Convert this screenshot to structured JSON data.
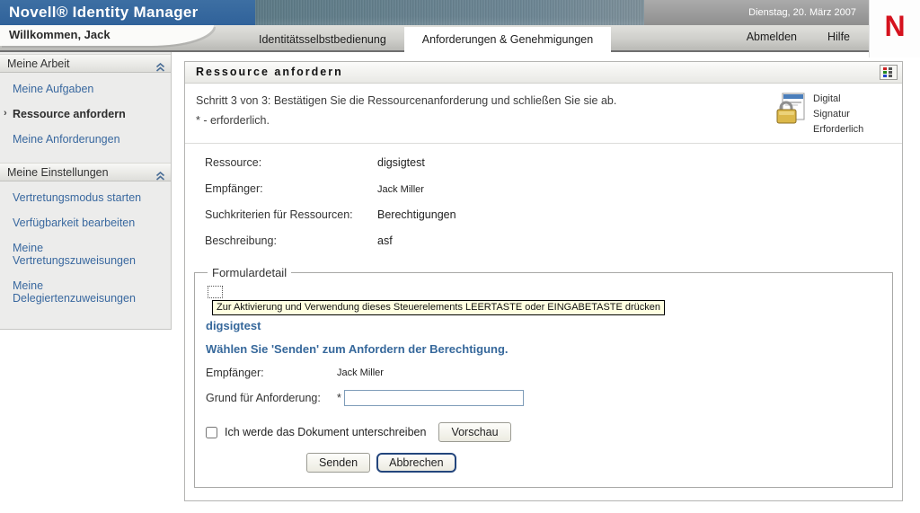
{
  "header": {
    "brand": "Novell® Identity Manager",
    "date": "Dienstag, 20. März 2007",
    "logo_letter": "N",
    "welcome": "Willkommen, Jack",
    "tabs": [
      {
        "label": "Identitätsselbstbedienung",
        "active": false
      },
      {
        "label": "Anforderungen & Genehmigungen",
        "active": true
      }
    ],
    "logout_label": "Abmelden",
    "help_label": "Hilfe"
  },
  "sidebar": {
    "sections": [
      {
        "title": "Meine Arbeit",
        "items": [
          {
            "label": "Meine Aufgaben",
            "active": false
          },
          {
            "label": "Ressource anfordern",
            "active": true
          },
          {
            "label": "Meine Anforderungen",
            "active": false
          }
        ]
      },
      {
        "title": "Meine Einstellungen",
        "items": [
          {
            "label": "Vertretungsmodus starten",
            "active": false
          },
          {
            "label": "Verfügbarkeit bearbeiten",
            "active": false
          },
          {
            "label": "Meine Vertretungszuweisungen",
            "active": false
          },
          {
            "label": "Meine Delegiertenzuweisungen",
            "active": false
          }
        ]
      }
    ]
  },
  "panel": {
    "title": "Ressource anfordern",
    "step_line1": "Schritt 3 von 3: Bestätigen Sie die Ressourcenanforderung und schließen Sie sie ab.",
    "step_line2": "* - erforderlich.",
    "digital_signature_label": "Digital Signatur Erforderlich",
    "summary_fields": [
      {
        "label": "Ressource:",
        "value": "digsigtest"
      },
      {
        "label": "Empfänger:",
        "value": "Jack Miller"
      },
      {
        "label": "Suchkriterien für Ressourcen:",
        "value": "Berechtigungen"
      },
      {
        "label": "Beschreibung:",
        "value": "asf"
      }
    ],
    "form": {
      "legend": "Formulardetail",
      "tooltip": "Zur Aktivierung und Verwendung dieses Steuerelements LEERTASTE oder EINGABETASTE drücken",
      "resource_title": "digsigtest",
      "instruction": "Wählen Sie 'Senden' zum Anfordern der Berechtigung.",
      "recipient_label": "Empfänger:",
      "recipient_value": "Jack Miller",
      "reason_label": "Grund für Anforderung:",
      "required_marker": "*",
      "reason_value": "",
      "sign_checkbox_label": "Ich werde das Dokument unterschreiben",
      "sign_checkbox_checked": false,
      "preview_button": "Vorschau",
      "submit_button": "Senden",
      "cancel_button": "Abbrechen"
    }
  },
  "colors": {
    "brand_bar_blue": "#35689d",
    "novell_red": "#d5121e",
    "link_blue": "#39689f",
    "accent_text_blue": "#36689b",
    "tooltip_bg": "#ffffe1"
  }
}
